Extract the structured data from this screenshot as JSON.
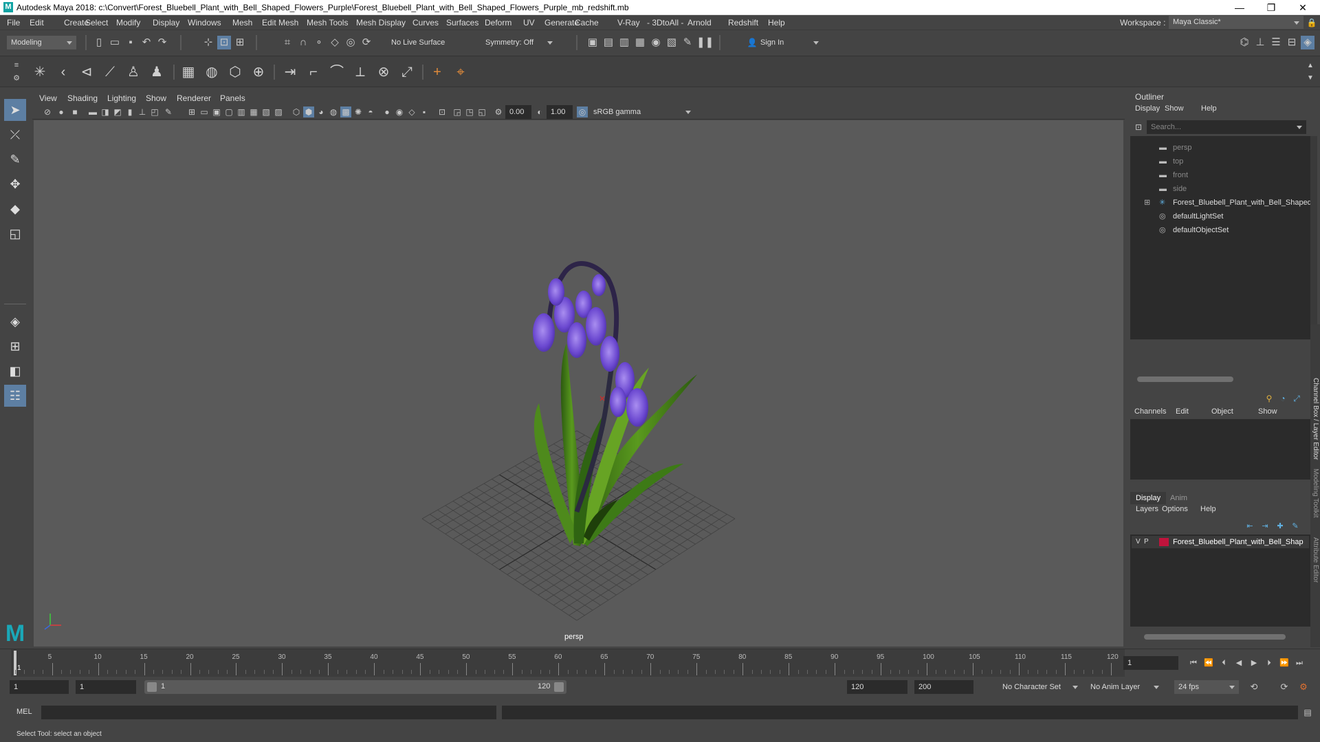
{
  "window": {
    "title": "Autodesk Maya 2018: c:\\Convert\\Forest_Bluebell_Plant_with_Bell_Shaped_Flowers_Purple\\Forest_Bluebell_Plant_with_Bell_Shaped_Flowers_Purple_mb_redshift.mb",
    "logo": "M",
    "minimize": "—",
    "maximize": "❐",
    "close": "✕"
  },
  "menubar": {
    "items": [
      "File",
      "Edit",
      "Create",
      "Select",
      "Modify",
      "Display",
      "Windows",
      "Mesh",
      "Edit Mesh",
      "Mesh Tools",
      "Mesh Display",
      "Curves",
      "Surfaces",
      "Deform",
      "UV",
      "Generate",
      "Cache",
      "V-Ray",
      "- 3DtoAll -",
      "Arnold",
      "Redshift",
      "Help"
    ],
    "workspace_label": "Workspace :",
    "workspace_value": "Maya Classic*"
  },
  "statusline": {
    "mode": "Modeling",
    "live_surface": "No Live Surface",
    "symmetry": "Symmetry: Off",
    "sign_in": "Sign In"
  },
  "viewport": {
    "menu": [
      "View",
      "Shading",
      "Lighting",
      "Show",
      "Renderer",
      "Panels"
    ],
    "exposure": "0.00",
    "gamma": "1.00",
    "colorspace": "sRGB gamma",
    "camera_label": "persp"
  },
  "outliner": {
    "title": "Outliner",
    "menu": [
      "Display",
      "Show",
      "Help"
    ],
    "search_placeholder": "Search...",
    "items": [
      {
        "label": "persp",
        "dim": true
      },
      {
        "label": "top",
        "dim": true
      },
      {
        "label": "front",
        "dim": true
      },
      {
        "label": "side",
        "dim": true
      },
      {
        "label": "Forest_Bluebell_Plant_with_Bell_Shaped",
        "dim": false
      },
      {
        "label": "defaultLightSet",
        "dim": false
      },
      {
        "label": "defaultObjectSet",
        "dim": false
      }
    ]
  },
  "channelbox": {
    "menu": [
      "Channels",
      "Edit",
      "Object",
      "Show"
    ],
    "side_tab": "Channel Box / Layer Editor",
    "side_tab2": "Modeling Toolkit",
    "side_tab3": "Attribute Editor"
  },
  "layereditor": {
    "tabs": [
      "Display",
      "Anim"
    ],
    "menu": [
      "Layers",
      "Options",
      "Help"
    ],
    "layer_v": "V",
    "layer_p": "P",
    "layer_name": "Forest_Bluebell_Plant_with_Bell_Shap",
    "layer_color": "#c0143c"
  },
  "timeline": {
    "ticks": [
      "5",
      "10",
      "15",
      "20",
      "25",
      "30",
      "35",
      "40",
      "45",
      "50",
      "55",
      "60",
      "65",
      "70",
      "75",
      "80",
      "85",
      "90",
      "95",
      "100",
      "105",
      "110",
      "115",
      "120"
    ],
    "current_frame_marker": "1",
    "current_frame": "1"
  },
  "range": {
    "start": "1",
    "playback_start": "1",
    "slider_start": "1",
    "slider_end": "120",
    "playback_end": "120",
    "end": "200",
    "character_set": "No Character Set",
    "anim_layer": "No Anim Layer",
    "fps": "24 fps"
  },
  "cmdline": {
    "label": "MEL"
  },
  "helpline": {
    "text": "Select Tool: select an object"
  }
}
